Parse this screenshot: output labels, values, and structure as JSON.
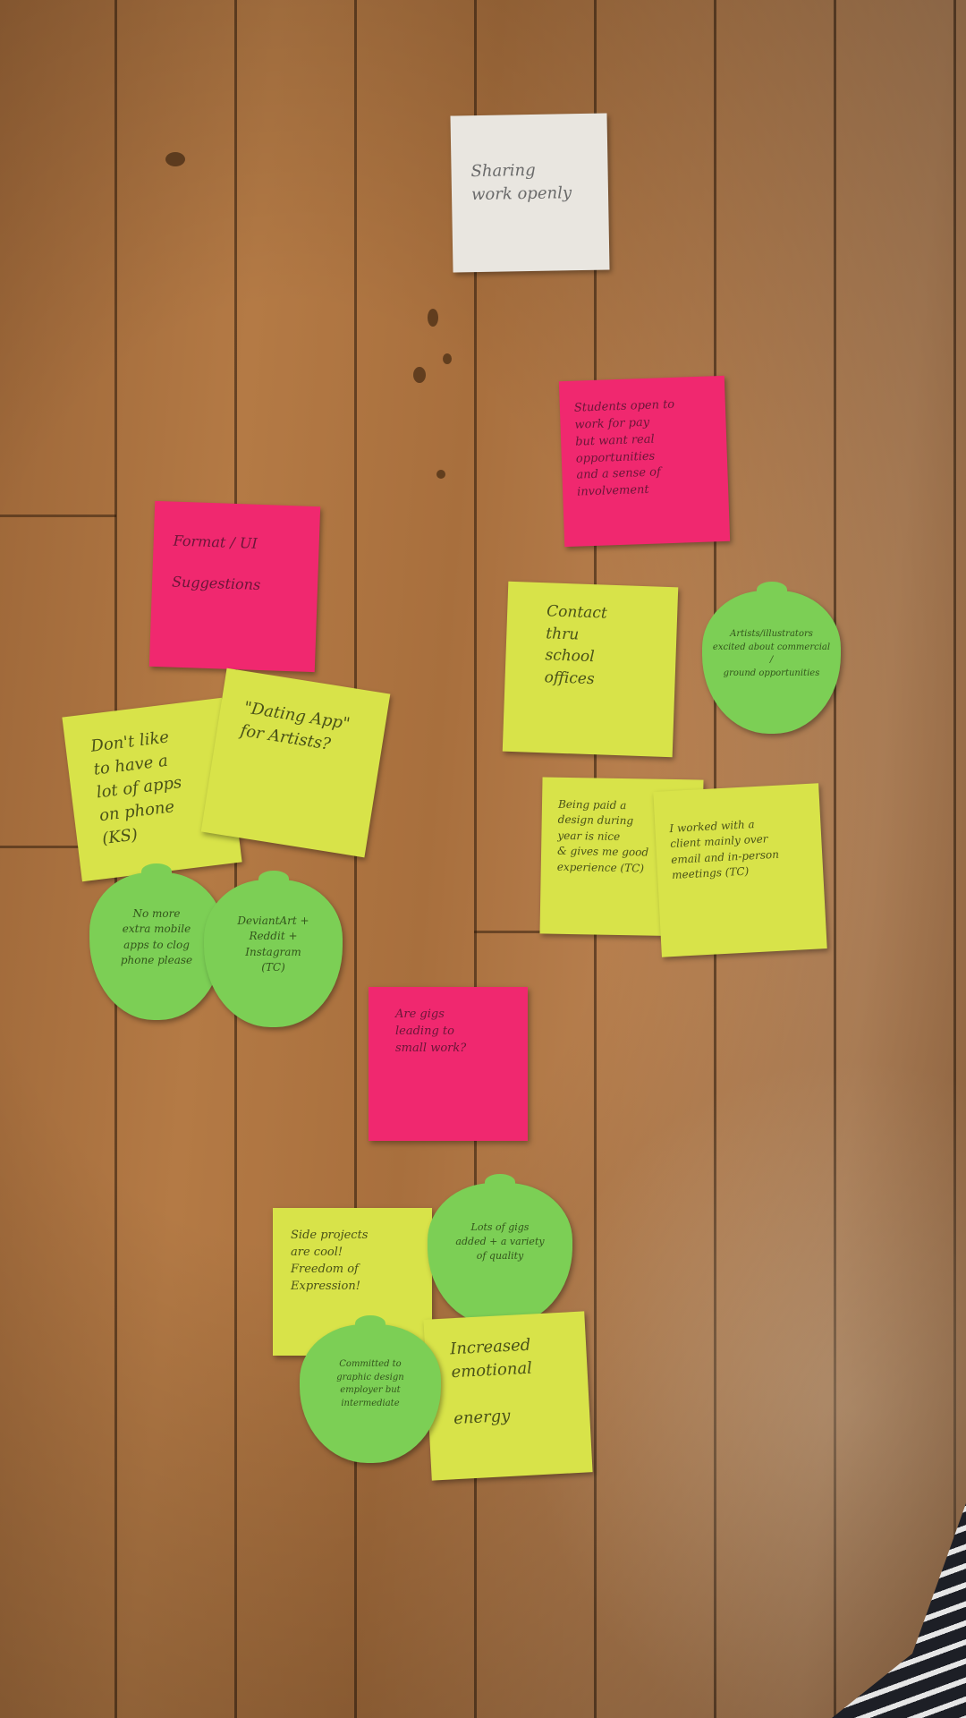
{
  "notes": [
    {
      "id": "sharing",
      "color": "white",
      "text": "Sharing\nwork openly"
    },
    {
      "id": "students",
      "color": "pink",
      "text": "Students open to\nwork for pay\nbut want real\nopportunities\nand a sense of\ninvolvement"
    },
    {
      "id": "format",
      "color": "pink",
      "text": "Format / UI\n\nSuggestions"
    },
    {
      "id": "contact",
      "color": "yellow",
      "text": "Contact\nthru\nschool offices"
    },
    {
      "id": "artists",
      "color": "green",
      "text": "Artists/illustrators\nexcited about commercial /\nground opportunities"
    },
    {
      "id": "dontlike",
      "color": "yellow",
      "text": "Don't like\nto have a\nlot of apps\non phone\n(KS)"
    },
    {
      "id": "dating",
      "color": "yellow",
      "text": "\"Dating App\"\nfor Artists?"
    },
    {
      "id": "beingpaid",
      "color": "yellow",
      "text": "Being paid a\ndesign during\nyear is nice\n& gives me good\nexperience (TC)"
    },
    {
      "id": "worked",
      "color": "yellow",
      "text": "I worked with a\nclient mainly over\nemail and in-person\nmeetings (TC)"
    },
    {
      "id": "nomore",
      "color": "green",
      "text": "No more\nextra mobile\napps to clog\nphone please"
    },
    {
      "id": "deviantart",
      "color": "green",
      "text": "DeviantArt +\nReddit +\nInstagram\n(TC)"
    },
    {
      "id": "aregigs",
      "color": "pink",
      "text": "Are gigs\nleading to\nsmall work?"
    },
    {
      "id": "side",
      "color": "yellow",
      "text": "Side projects\nare cool!\nFreedom of\nExpression!"
    },
    {
      "id": "lotsof",
      "color": "green",
      "text": "Lots of gigs\nadded + a variety\nof quality"
    },
    {
      "id": "committed",
      "color": "green",
      "text": "Committed to\ngraphic design\nemployer but\nintermediate"
    },
    {
      "id": "emotional",
      "color": "yellow",
      "text": "Increased\nemotional\n\nenergy"
    }
  ]
}
